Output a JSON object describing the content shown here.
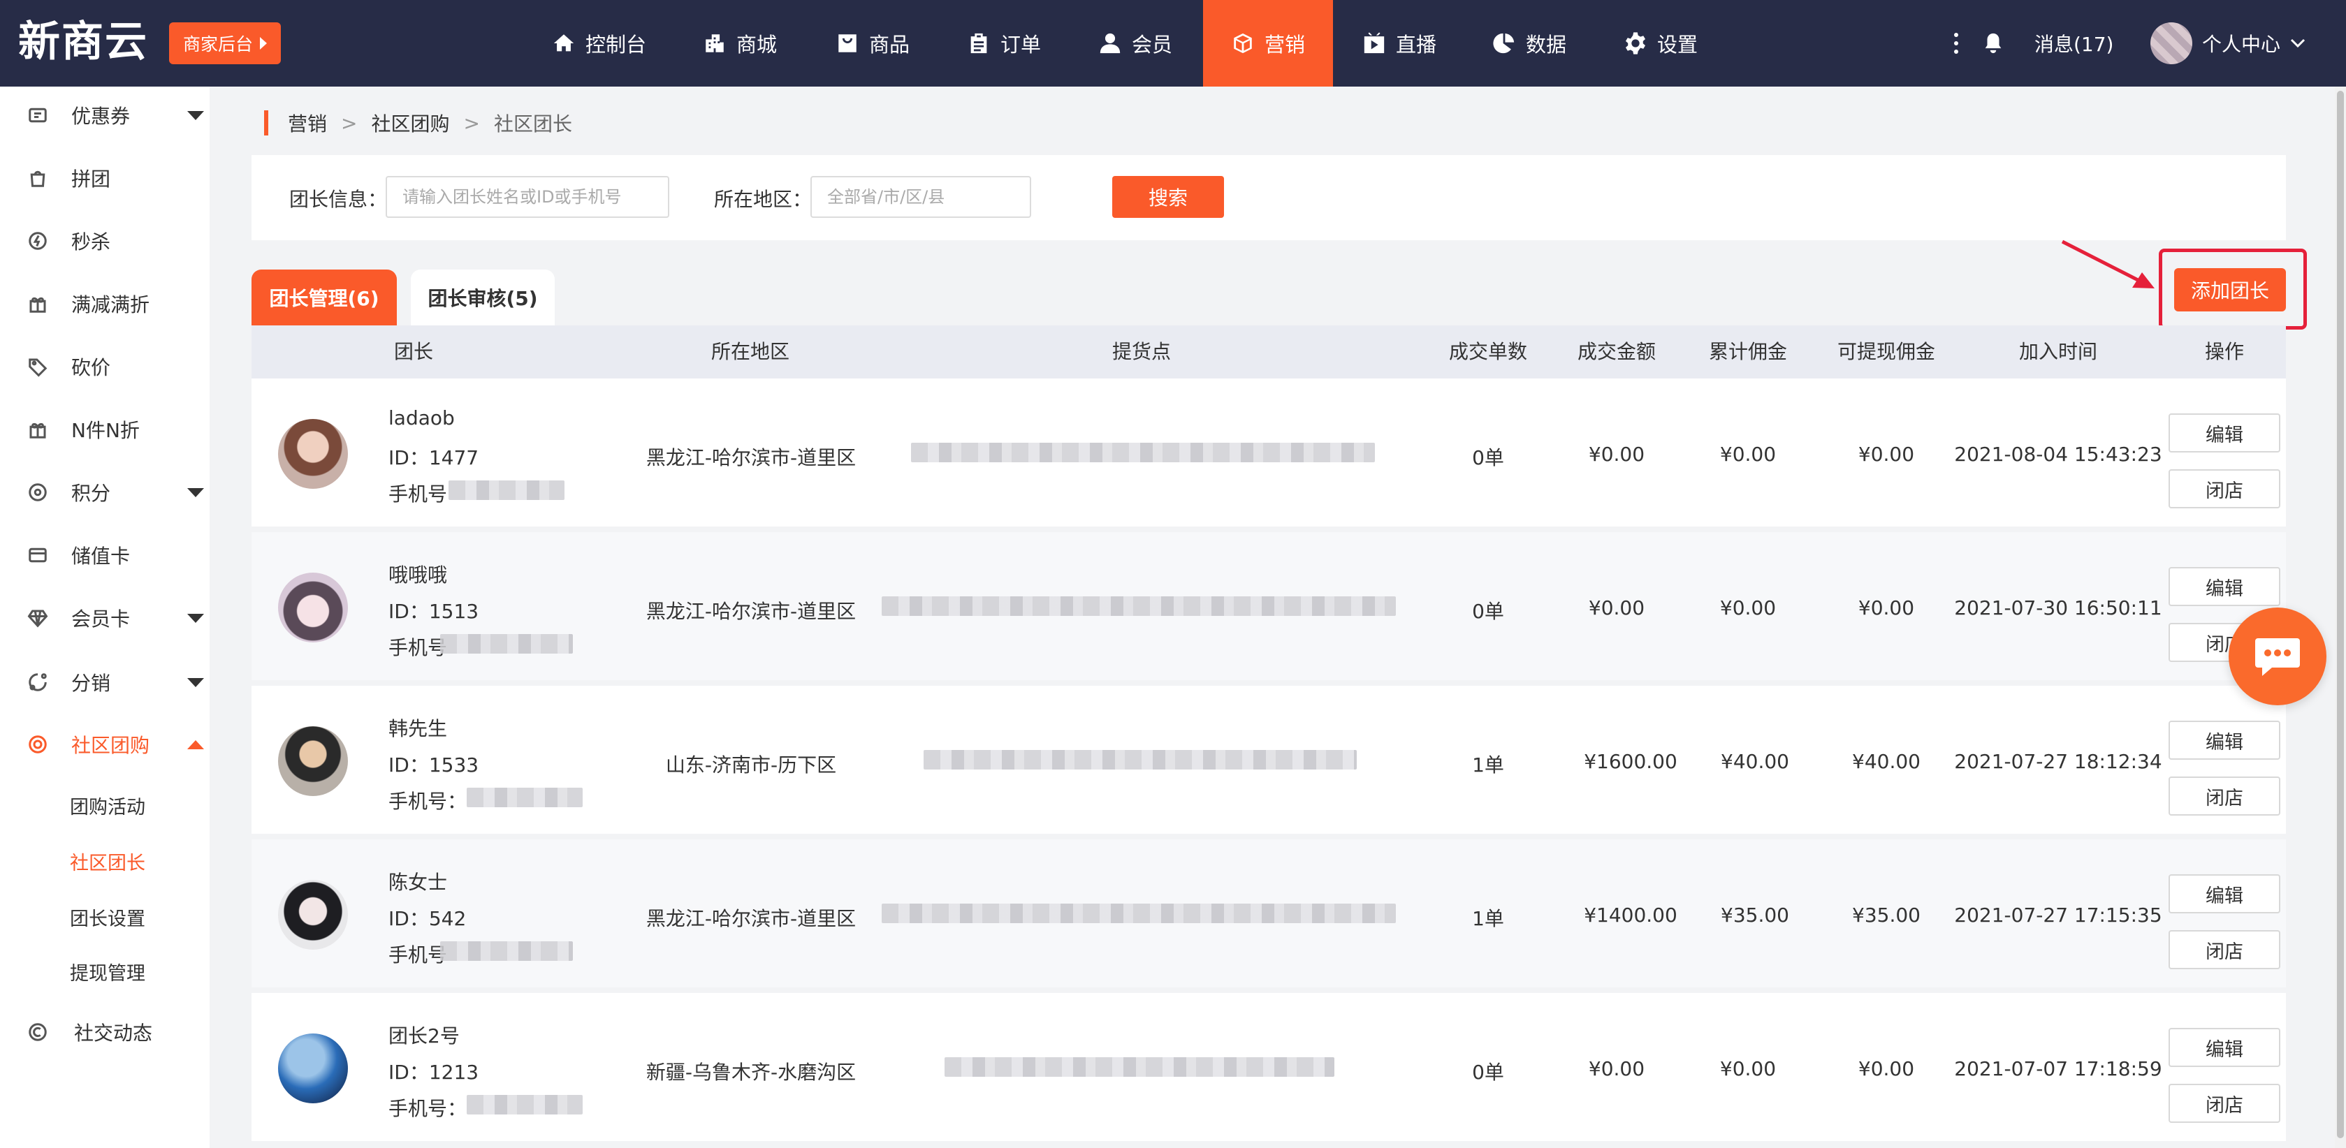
{
  "app": {
    "logo_text": "新商云",
    "merchant_label": "商家后台"
  },
  "topnav": {
    "items": [
      {
        "label": "控制台",
        "icon": "home-icon"
      },
      {
        "label": "商城",
        "icon": "building-icon"
      },
      {
        "label": "商品",
        "icon": "bag-icon"
      },
      {
        "label": "订单",
        "icon": "clipboard-icon"
      },
      {
        "label": "会员",
        "icon": "user-icon"
      },
      {
        "label": "营销",
        "icon": "cube-icon",
        "active": true
      },
      {
        "label": "直播",
        "icon": "play-icon"
      },
      {
        "label": "数据",
        "icon": "pie-icon"
      },
      {
        "label": "设置",
        "icon": "gear-icon"
      }
    ],
    "messages_label": "消息(17)",
    "user_center_label": "个人中心"
  },
  "sidebar": {
    "items": [
      {
        "label": "优惠券",
        "icon": "coupon-icon",
        "expandable": true
      },
      {
        "label": "拼团",
        "icon": "bag-icon"
      },
      {
        "label": "秒杀",
        "icon": "flash-icon"
      },
      {
        "label": "满减满折",
        "icon": "gift-icon"
      },
      {
        "label": "砍价",
        "icon": "tag-icon"
      },
      {
        "label": "N件N折",
        "icon": "gift-icon"
      },
      {
        "label": "积分",
        "icon": "points-icon",
        "expandable": true
      },
      {
        "label": "储值卡",
        "icon": "card-icon"
      },
      {
        "label": "会员卡",
        "icon": "diamond-icon",
        "expandable": true
      },
      {
        "label": "分销",
        "icon": "share-icon",
        "expandable": true
      },
      {
        "label": "社区团购",
        "icon": "community-icon",
        "expandable": true,
        "active": true
      }
    ],
    "subitems": [
      {
        "label": "团购活动"
      },
      {
        "label": "社区团长",
        "active": true
      },
      {
        "label": "团长设置"
      },
      {
        "label": "提现管理"
      }
    ],
    "bottom_item": {
      "label": "社交动态",
      "icon": "social-icon"
    }
  },
  "breadcrumb": [
    "营销",
    "社区团购",
    "社区团长"
  ],
  "search": {
    "leader_label": "团长信息：",
    "leader_placeholder": "请输入团长姓名或ID或手机号",
    "region_label": "所在地区：",
    "region_placeholder": "全部省/市/区/县",
    "search_button": "搜索"
  },
  "tabs": [
    {
      "label": "团长管理(6)",
      "active": true
    },
    {
      "label": "团长审核(5)"
    }
  ],
  "add_button": "添加团长",
  "table": {
    "headers": [
      "团长",
      "所在地区",
      "提货点",
      "成交单数",
      "成交金额",
      "累计佣金",
      "可提现佣金",
      "加入时间",
      "操作"
    ],
    "rows": [
      {
        "name": "ladaob",
        "id": "ID：1477",
        "phone": "手机号",
        "region": "黑龙江-哈尔滨市-道里区",
        "orders": "0单",
        "amount": "¥0.00",
        "commission": "¥0.00",
        "withdrawable": "¥0.00",
        "joined": "2021-08-04 15:43:23",
        "edit": "编辑",
        "close": "闭店"
      },
      {
        "name": "哦哦哦",
        "id": "ID：1513",
        "phone": "手机号",
        "region": "黑龙江-哈尔滨市-道里区",
        "orders": "0单",
        "amount": "¥0.00",
        "commission": "¥0.00",
        "withdrawable": "¥0.00",
        "joined": "2021-07-30 16:50:11",
        "edit": "编辑",
        "close": "闭店"
      },
      {
        "name": "韩先生",
        "id": "ID：1533",
        "phone": "手机号：",
        "region": "山东-济南市-历下区",
        "orders": "1单",
        "amount": "¥1600.00",
        "commission": "¥40.00",
        "withdrawable": "¥40.00",
        "joined": "2021-07-27 18:12:34",
        "edit": "编辑",
        "close": "闭店"
      },
      {
        "name": "陈女士",
        "id": "ID：542",
        "phone": "手机号",
        "region": "黑龙江-哈尔滨市-道里区",
        "orders": "1单",
        "amount": "¥1400.00",
        "commission": "¥35.00",
        "withdrawable": "¥35.00",
        "joined": "2021-07-27 17:15:35",
        "edit": "编辑",
        "close": "闭店"
      },
      {
        "name": "团长2号",
        "id": "ID：1213",
        "phone": "手机号：",
        "region": "新疆-乌鲁木齐-水磨沟区",
        "orders": "0单",
        "amount": "¥0.00",
        "commission": "¥0.00",
        "withdrawable": "¥0.00",
        "joined": "2021-07-07 17:18:59",
        "edit": "编辑",
        "close": "闭店"
      }
    ]
  },
  "colors": {
    "accent": "#fa5a2a",
    "topbar": "#272c47",
    "highlight": "#e5203a"
  }
}
